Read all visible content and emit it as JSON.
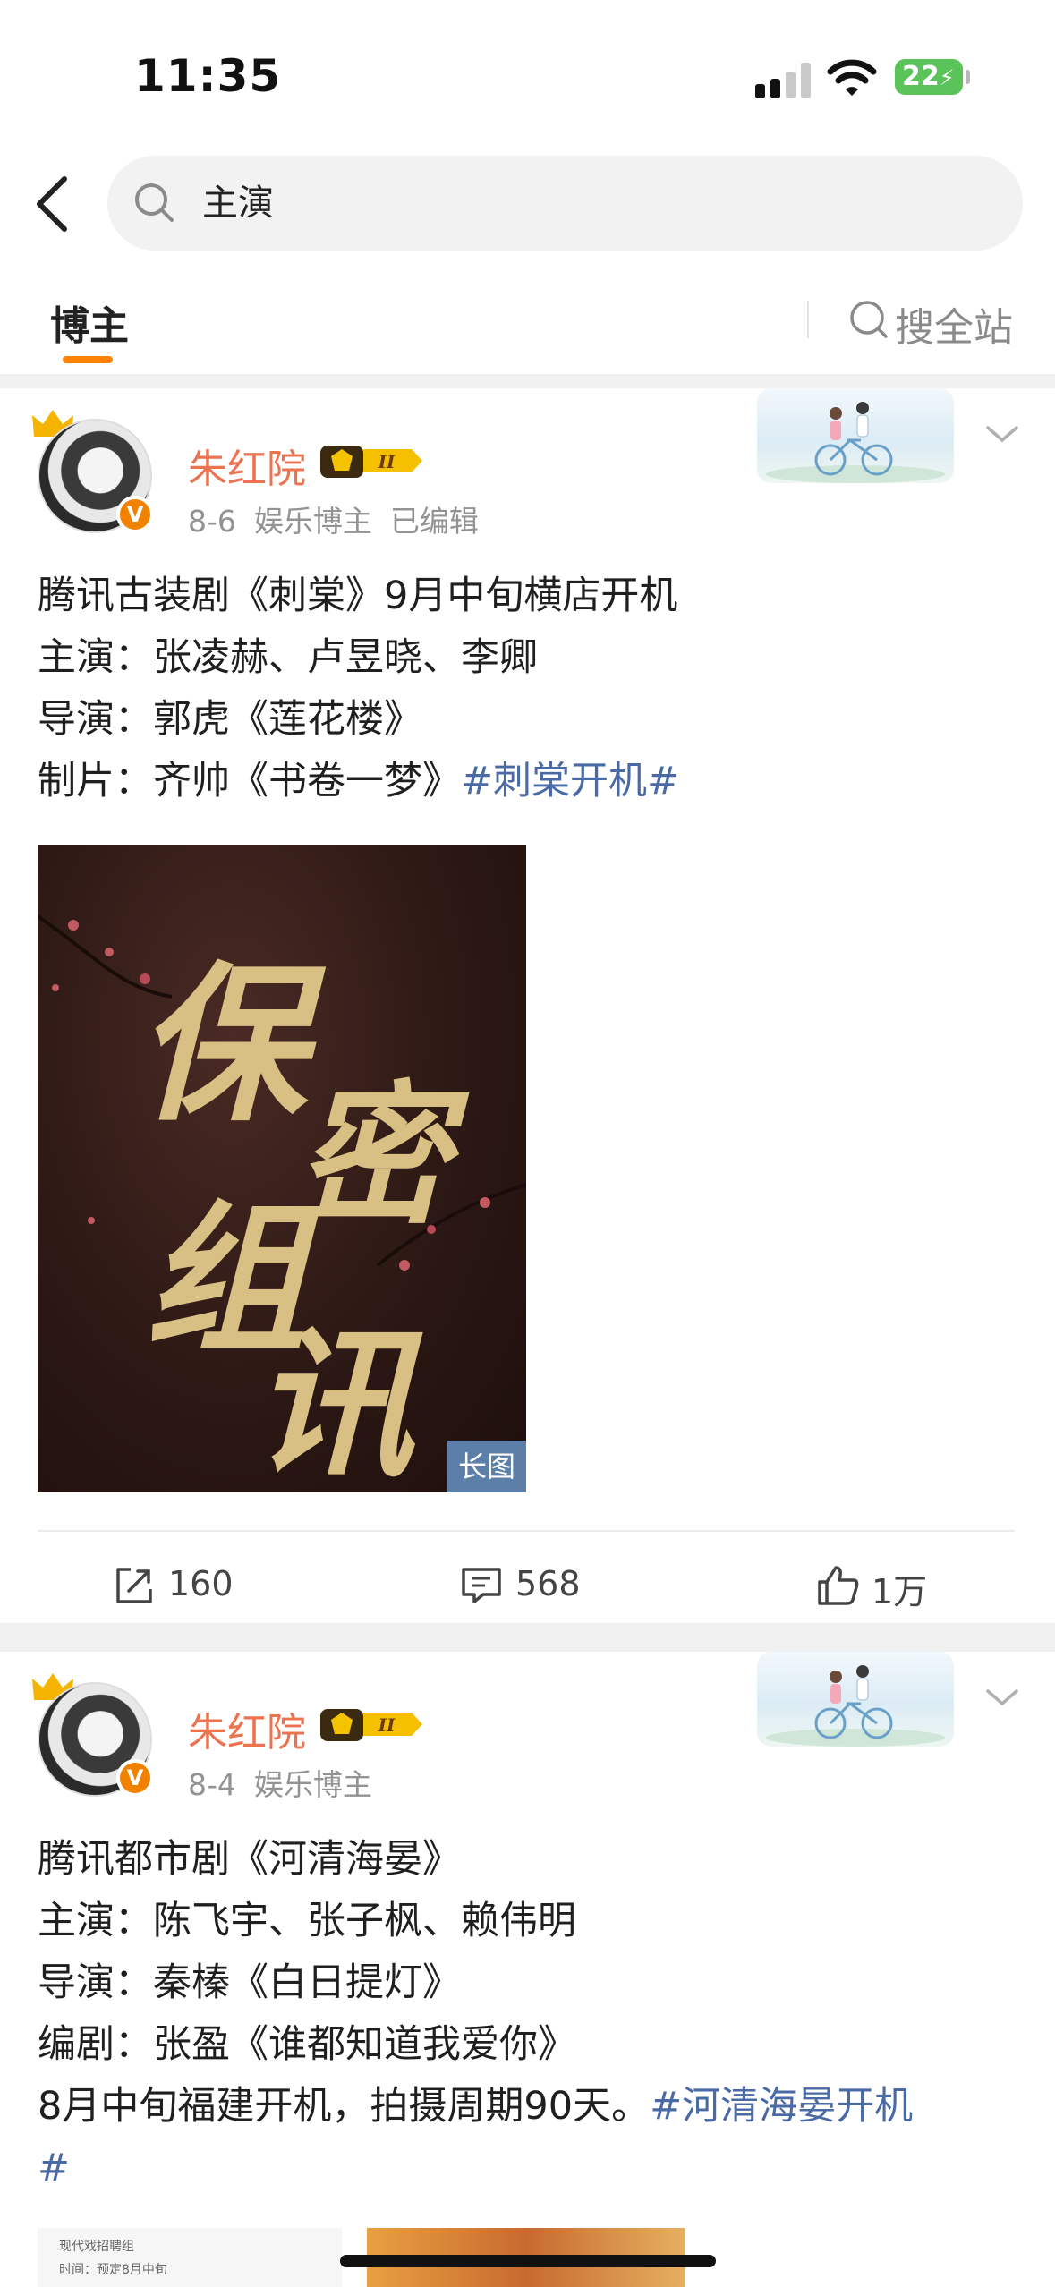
{
  "status": {
    "time": "11:35",
    "battery": "22"
  },
  "search": {
    "query": "主演"
  },
  "tabs": {
    "active": "博主",
    "search_all": "搜全站"
  },
  "posts": [
    {
      "username": "朱红院",
      "level": "II",
      "date": "8-6",
      "category": "娱乐博主",
      "edited": "已编辑",
      "lines": [
        "腾讯古装剧《刺棠》9月中旬横店开机",
        "主演：张凌赫、卢昱晓、李卿",
        "导演：郭虎《莲花楼》",
        "制片：齐帅《书卷一梦》"
      ],
      "hashtag": "#刺棠开机#",
      "image": {
        "chars": [
          "保",
          "密",
          "组",
          "讯"
        ],
        "badge": "长图"
      },
      "reposts": "160",
      "comments": "568",
      "likes": "1万"
    },
    {
      "username": "朱红院",
      "level": "II",
      "date": "8-4",
      "category": "娱乐博主",
      "lines": [
        "腾讯都市剧《河清海晏》",
        "主演：陈飞宇、张子枫、赖伟明",
        "导演：秦榛《白日提灯》",
        "编剧：张盈《谁都知道我爱你》"
      ],
      "last_line": "8月中旬福建开机，拍摄周期90天。",
      "hashtag_a": "#河清海晏开机",
      "hashtag_b": "#",
      "thumb_text_a": "现代戏招聘组",
      "thumb_text_b": "时间：预定8月中旬"
    }
  ],
  "colors": {
    "accent": "#ff8200",
    "username": "#eb7350",
    "hashtag": "#4a6aa5"
  }
}
